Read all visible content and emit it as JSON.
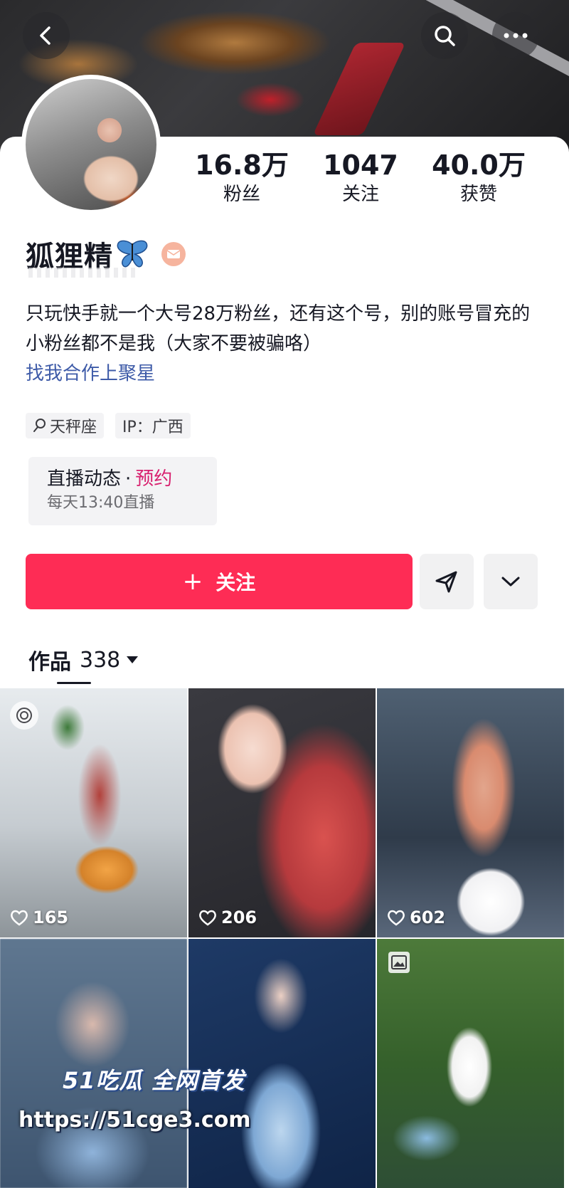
{
  "header": {
    "back_icon": "chevron-left-icon",
    "search_icon": "search-icon",
    "more_icon": "more-icon"
  },
  "profile": {
    "stats": [
      {
        "value": "16.8万",
        "label": "粉丝"
      },
      {
        "value": "1047",
        "label": "关注"
      },
      {
        "value": "40.0万",
        "label": "获赞"
      }
    ],
    "name": "狐狸精",
    "bio": "只玩快手就一个大号28万粉丝，还有这个号，别的账号冒充的小粉丝都不是我（大家不要被骗咯）",
    "bio_link": "找我合作上聚星",
    "tags": [
      "天秤座",
      "IP：广西"
    ],
    "live": {
      "title": "直播动态",
      "separator": "·",
      "reserve": "预约",
      "schedule": "每天13:40直播"
    }
  },
  "actions": {
    "follow_plus": "+",
    "follow_label": "关注",
    "share_icon": "send-icon",
    "more_icon": "chevron-down-icon"
  },
  "works": {
    "tab_label": "作品",
    "count": "338"
  },
  "videos": [
    {
      "likes": "165"
    },
    {
      "likes": "206"
    },
    {
      "likes": "602"
    },
    {},
    {},
    {}
  ],
  "watermark": {
    "brand": "51吃瓜 全网首发",
    "url": "https://51cge3.com"
  },
  "colors": {
    "follow_button": "#fe2c55",
    "link": "#3e5ba8",
    "reserve": "#d81f6e"
  }
}
